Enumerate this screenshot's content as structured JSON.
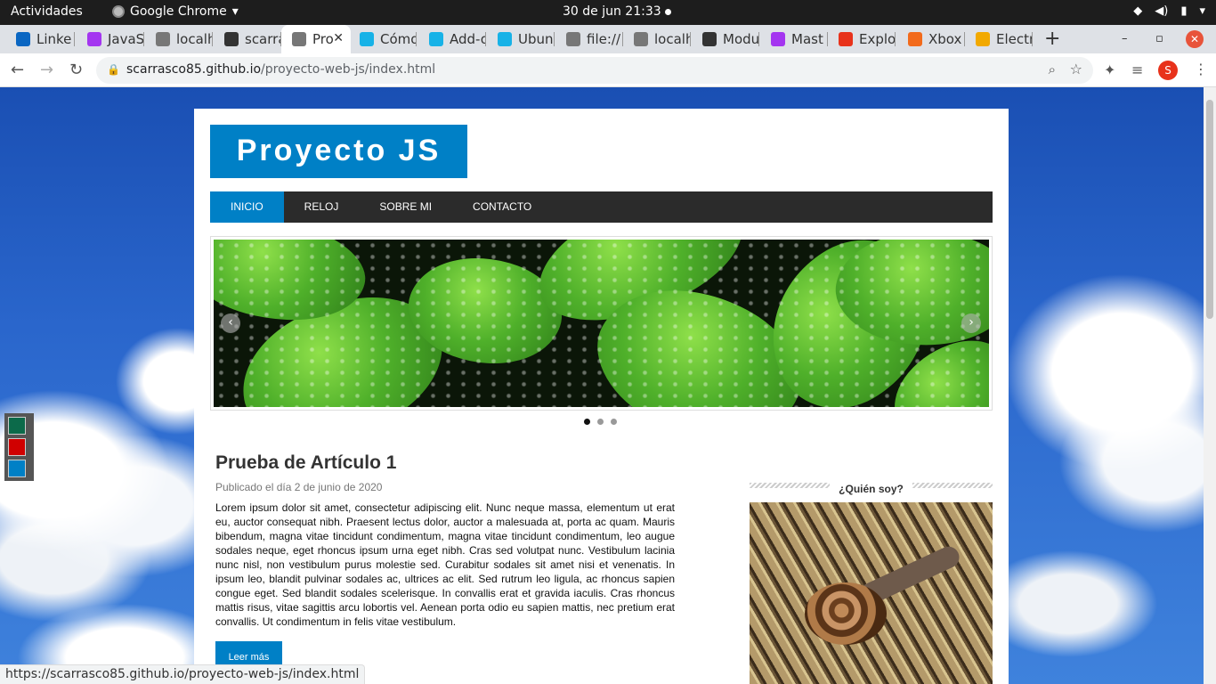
{
  "topbar": {
    "activities": "Actividades",
    "app_name": "Google Chrome",
    "clock": "30 de jun  21:33"
  },
  "tabs": [
    {
      "label": "Linke",
      "icon": "linkedin-icon",
      "color": "#0a66c2"
    },
    {
      "label": "JavaS",
      "icon": "udemy-icon",
      "color": "#a435f0"
    },
    {
      "label": "localh",
      "icon": "globe-icon",
      "color": "#777777"
    },
    {
      "label": "scarra",
      "icon": "github-icon",
      "color": "#333333"
    },
    {
      "label": "Pro",
      "icon": "globe-icon",
      "color": "#777777",
      "active": true
    },
    {
      "label": "Cómo",
      "icon": "kodi-icon",
      "color": "#17b2e7"
    },
    {
      "label": "Add-o",
      "icon": "kodi-icon",
      "color": "#17b2e7"
    },
    {
      "label": "Ubun",
      "icon": "kodi-icon",
      "color": "#17b2e7"
    },
    {
      "label": "file://",
      "icon": "globe-icon",
      "color": "#777777"
    },
    {
      "label": "localh",
      "icon": "globe-icon",
      "color": "#777777"
    },
    {
      "label": "Modu",
      "icon": "github-icon",
      "color": "#333333"
    },
    {
      "label": "Mast",
      "icon": "udemy-icon",
      "color": "#a435f0"
    },
    {
      "label": "Explo",
      "icon": "x-icon",
      "color": "#e8321b"
    },
    {
      "label": "Xbox",
      "icon": "fire-icon",
      "color": "#f26a1b"
    },
    {
      "label": "Electr",
      "icon": "bitcoin-icon",
      "color": "#f2a900"
    }
  ],
  "toolbar": {
    "url_host": "scarrasco85.github.io",
    "url_path": "/proyecto-web-js/index.html",
    "profile_initial": "S"
  },
  "site": {
    "logo": "Proyecto JS",
    "menu": [
      "INICIO",
      "RELOJ",
      "SOBRE MI",
      "CONTACTO"
    ],
    "theme_colors": [
      "#0c6a4a",
      "#d00000",
      "#0080c6"
    ],
    "accent": "#0080c6"
  },
  "article": {
    "title": "Prueba de Artículo 1",
    "meta": "Publicado el día 2 de junio de 2020",
    "body": "Lorem ipsum dolor sit amet, consectetur adipiscing elit. Nunc neque massa, elementum ut erat eu, auctor consequat nibh. Praesent lectus dolor, auctor a malesuada at, porta ac quam. Mauris bibendum, magna vitae tincidunt condimentum, magna vitae tincidunt condimentum, leo augue sodales neque, eget rhoncus ipsum urna eget nibh. Cras sed volutpat nunc. Vestibulum lacinia nunc nisl, non vestibulum purus molestie sed. Curabitur sodales sit amet nisi et venenatis. In ipsum leo, blandit pulvinar sodales ac, ultrices ac elit. Sed rutrum leo ligula, ac rhoncus sapien congue eget. Sed blandit sodales scelerisque. In convallis erat et gravida iaculis. Cras rhoncus mattis risus, vitae sagittis arcu lobortis vel. Aenean porta odio eu sapien mattis, nec pretium erat convallis. Ut condimentum in felis vitae vestibulum.",
    "read_more": "Leer más"
  },
  "sidebar": {
    "heading": "¿Quién soy?"
  },
  "status_url": "https://scarrasco85.github.io/proyecto-web-js/index.html"
}
